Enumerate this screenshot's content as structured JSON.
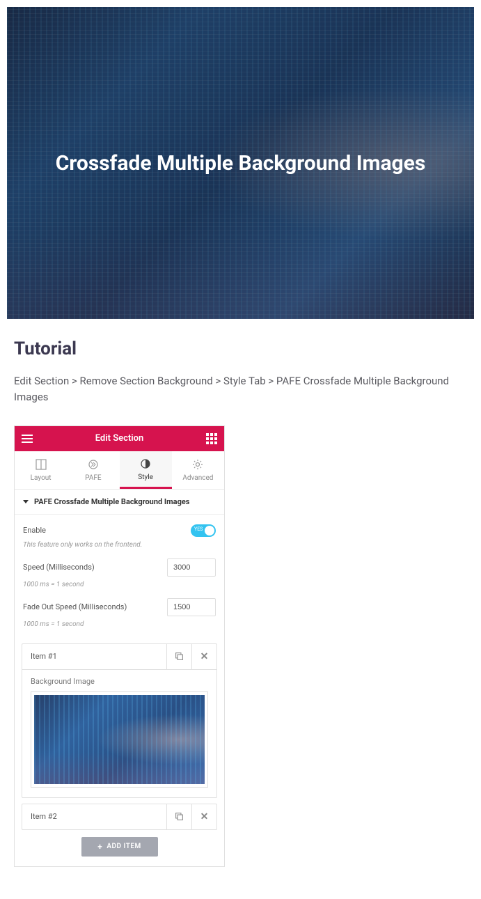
{
  "hero": {
    "title": "Crossfade Multiple Background Images"
  },
  "tutorial": {
    "heading": "Tutorial",
    "breadcrumb": "Edit Section > Remove Section Background > Style Tab > PAFE Crossfade Multiple Background Images"
  },
  "app": {
    "header_title": "Edit Section",
    "tabs": {
      "layout": "Layout",
      "pafe": "PAFE",
      "style": "Style",
      "advanced": "Advanced"
    },
    "accordion_title": "PAFE Crossfade Multiple Background Images",
    "enable": {
      "label": "Enable",
      "toggle_text": "YES",
      "hint": "This feature only works on the frontend."
    },
    "speed": {
      "label": "Speed (Milliseconds)",
      "value": "3000",
      "hint": "1000 ms = 1 second"
    },
    "fade_out": {
      "label": "Fade Out Speed (Milliseconds)",
      "value": "1500",
      "hint": "1000 ms = 1 second"
    },
    "items": {
      "item1_title": "Item #1",
      "bg_label": "Background Image",
      "item2_title": "Item #2"
    },
    "add_button": "ADD ITEM"
  }
}
